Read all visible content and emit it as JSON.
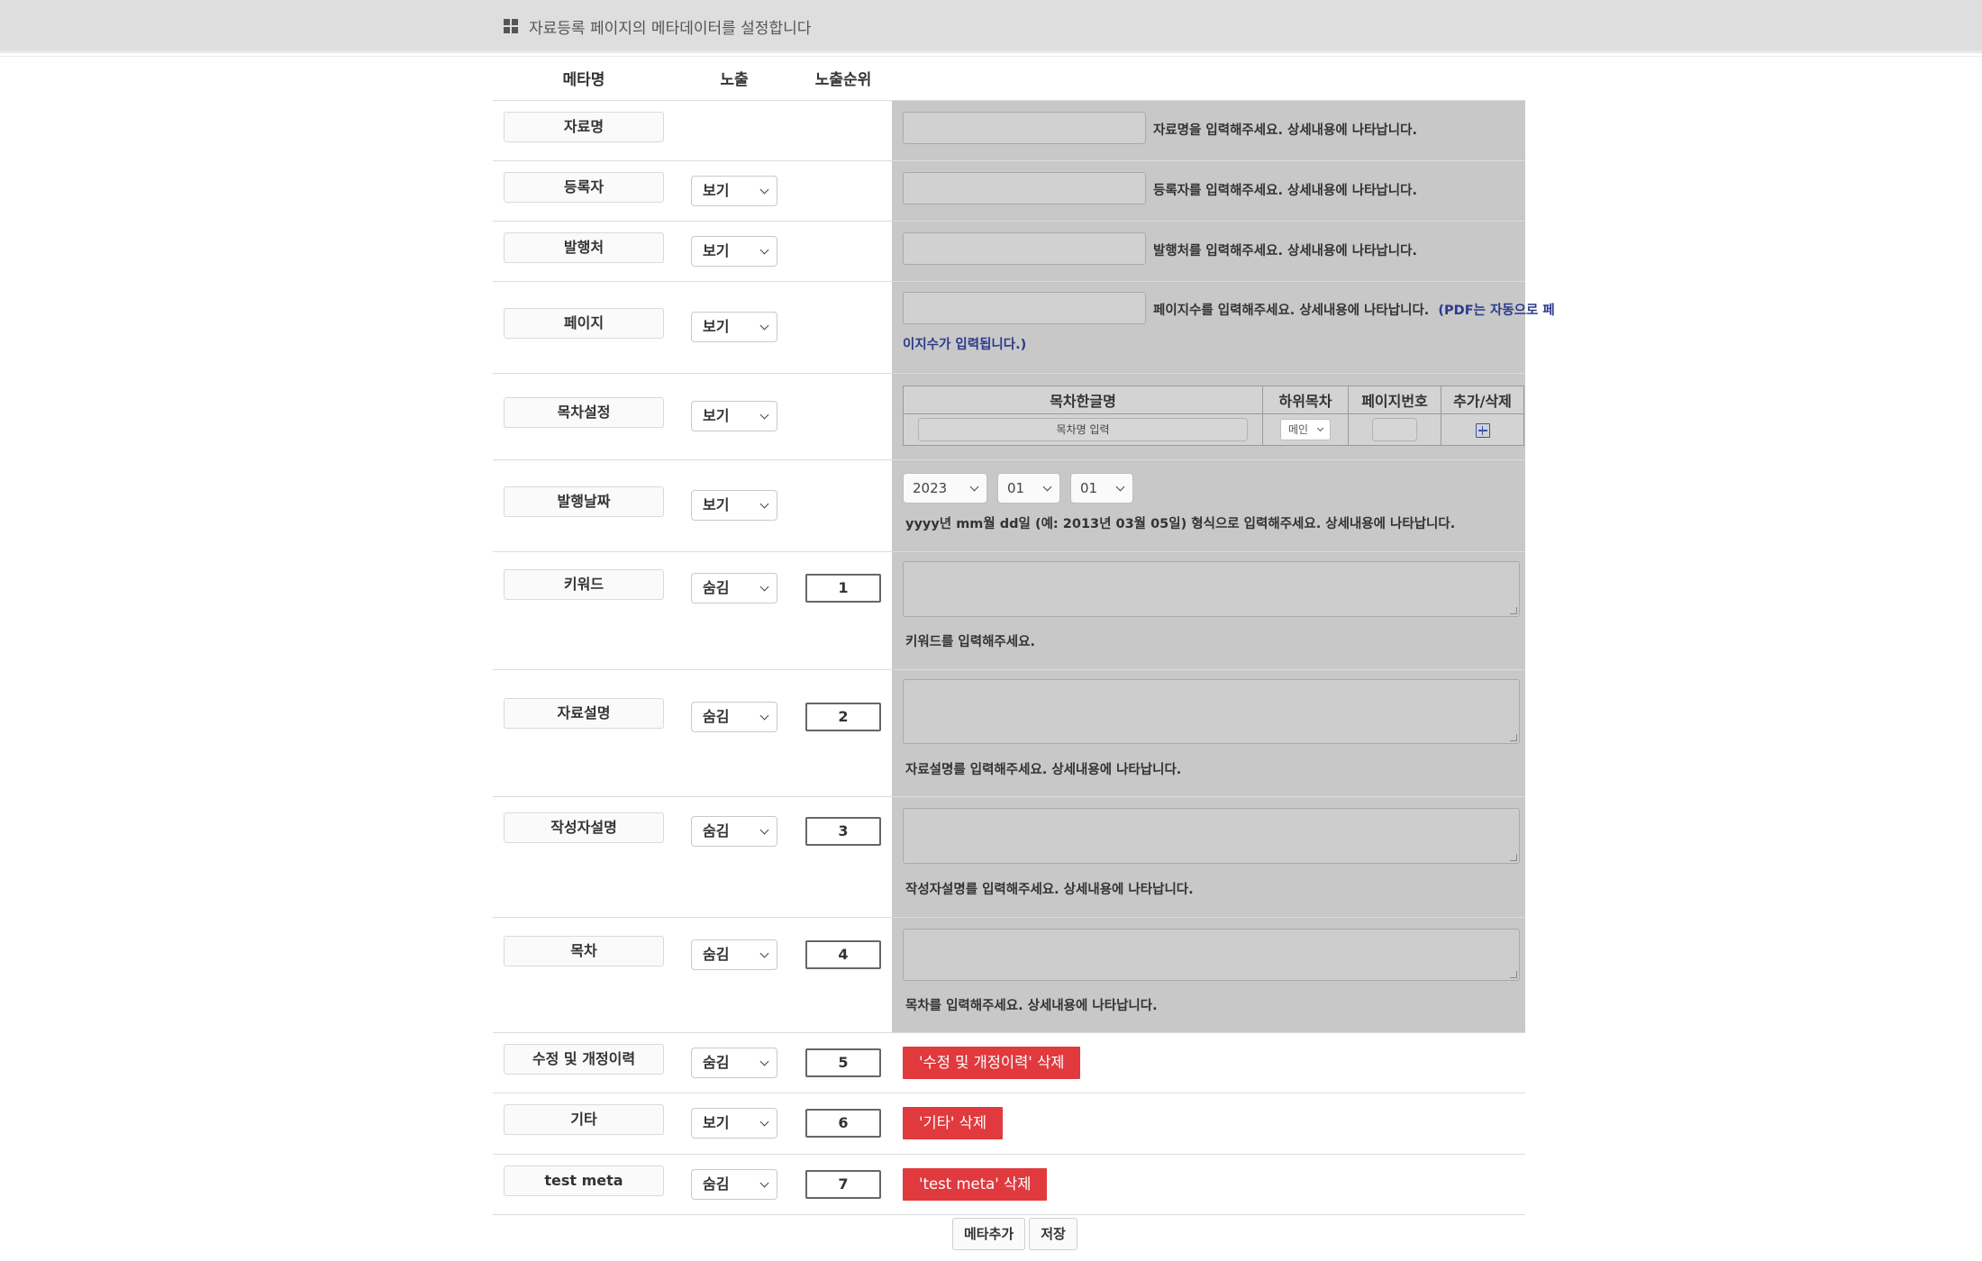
{
  "header": {
    "title": "자료등록 페이지의 메타데이터를 설정합니다"
  },
  "columns": {
    "meta_name": "메타명",
    "exposure": "노출",
    "order": "노출순위"
  },
  "rows": {
    "title": {
      "name": "자료명",
      "hint": "자료명을 입력해주세요. 상세내용에 나타납니다."
    },
    "registrant": {
      "name": "등록자",
      "exposure": "보기",
      "hint": "등록자를 입력해주세요. 상세내용에 나타납니다."
    },
    "publisher": {
      "name": "발행처",
      "exposure": "보기",
      "hint": "발행처를 입력해주세요. 상세내용에 나타납니다."
    },
    "pages": {
      "name": "페이지",
      "exposure": "보기",
      "hint": "페이지수를 입력해주세요. 상세내용에 나타납니다.",
      "hint_note_1": "(PDF는 자동으로 페",
      "hint_note_2": "이지수가 입력됩니다.)"
    },
    "toc_setting": {
      "name": "목차설정",
      "exposure": "보기",
      "table": {
        "headers": [
          "목차한글명",
          "하위목차",
          "페이지번호",
          "추가/삭제"
        ],
        "toc_name_placeholder": "목차명 입력",
        "sub_select": "메인"
      }
    },
    "pub_date": {
      "name": "발행날짜",
      "exposure": "보기",
      "year": "2023",
      "month": "01",
      "day": "01",
      "hint": "yyyy년 mm월 dd일 (예: 2013년 03월 05일) 형식으로 입력해주세요. 상세내용에 나타납니다."
    },
    "keyword": {
      "name": "키워드",
      "exposure": "숨김",
      "order": "1",
      "hint": "키워드를 입력해주세요."
    },
    "description": {
      "name": "자료설명",
      "exposure": "숨김",
      "order": "2",
      "hint": "자료설명를 입력해주세요. 상세내용에 나타납니다."
    },
    "author_desc": {
      "name": "작성자설명",
      "exposure": "숨김",
      "order": "3",
      "hint": "작성자설명를 입력해주세요. 상세내용에 나타납니다."
    },
    "toc": {
      "name": "목차",
      "exposure": "숨김",
      "order": "4",
      "hint": "목차를 입력해주세요. 상세내용에 나타납니다."
    },
    "revision": {
      "name": "수정 및 개정이력",
      "exposure": "숨김",
      "order": "5",
      "delete_label": "'수정 및 개정이력' 삭제"
    },
    "etc": {
      "name": "기타",
      "exposure": "보기",
      "order": "6",
      "delete_label": "'기타' 삭제"
    },
    "test_meta": {
      "name": "test meta",
      "exposure": "숨김",
      "order": "7",
      "delete_label": "'test meta' 삭제"
    }
  },
  "buttons": {
    "add_meta": "메타추가",
    "save": "저장"
  },
  "colors": {
    "delete_button": "#e03a3e",
    "gray_panel": "#c8c8c8",
    "toc_plus": "#3b52a6",
    "hint_note": "#2b3a8c"
  }
}
